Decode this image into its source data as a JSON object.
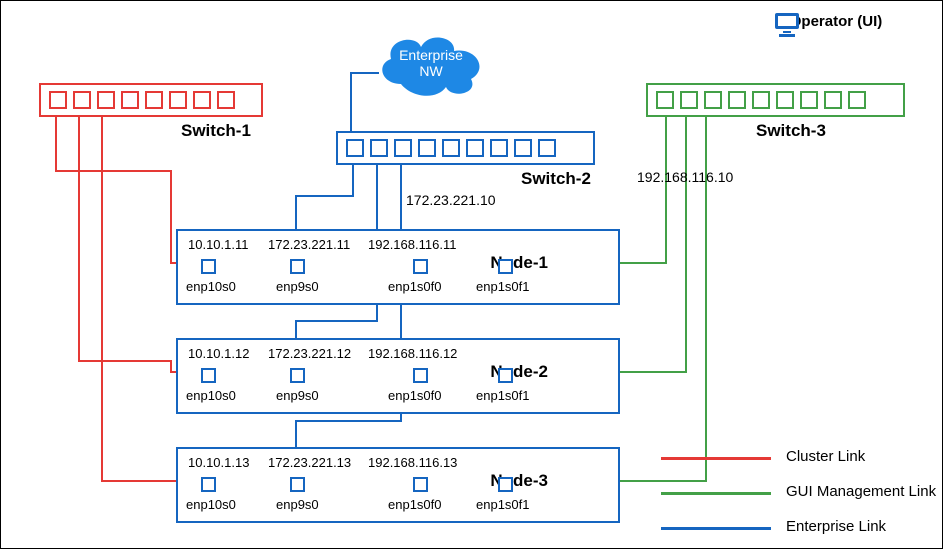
{
  "switches": {
    "s1": {
      "label": "Switch-1"
    },
    "s2": {
      "label": "Switch-2",
      "ip": "172.23.221.10"
    },
    "s3": {
      "label": "Switch-3",
      "ip": "192.168.116.10"
    }
  },
  "cloud": {
    "label_line1": "Enterprise",
    "label_line2": "NW"
  },
  "operator": {
    "label": "Operator (UI)"
  },
  "nodes": [
    {
      "title": "Node-1",
      "ifs": [
        {
          "ip": "10.10.1.11",
          "name": "enp10s0"
        },
        {
          "ip": "172.23.221.11",
          "name": "enp9s0"
        },
        {
          "ip": "192.168.116.11",
          "name": "enp1s0f0"
        },
        {
          "ip": "",
          "name": "enp1s0f1"
        }
      ]
    },
    {
      "title": "Node-2",
      "ifs": [
        {
          "ip": "10.10.1.12",
          "name": "enp10s0"
        },
        {
          "ip": "172.23.221.12",
          "name": "enp9s0"
        },
        {
          "ip": "192.168.116.12",
          "name": "enp1s0f0"
        },
        {
          "ip": "",
          "name": "enp1s0f1"
        }
      ]
    },
    {
      "title": "Node-3",
      "ifs": [
        {
          "ip": "10.10.1.13",
          "name": "enp10s0"
        },
        {
          "ip": "172.23.221.13",
          "name": "enp9s0"
        },
        {
          "ip": "192.168.116.13",
          "name": "enp1s0f0"
        },
        {
          "ip": "",
          "name": "enp1s0f1"
        }
      ]
    }
  ],
  "legend": {
    "cluster": "Cluster Link",
    "gui": "GUI Management Link",
    "enterprise": "Enterprise Link"
  },
  "colors": {
    "cluster": "#E53935",
    "enterprise": "#1565C0",
    "gui": "#43A047",
    "cloud": "#1E88E5"
  }
}
